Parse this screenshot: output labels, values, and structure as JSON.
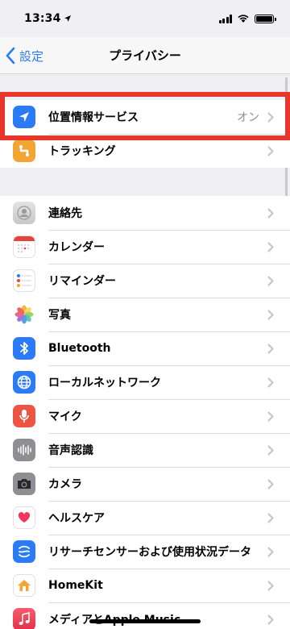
{
  "status_bar": {
    "time": "13:34",
    "location_arrow": "location-arrow-icon"
  },
  "nav": {
    "back_label": "設定",
    "title": "プライバシー"
  },
  "section1": [
    {
      "label": "位置情報サービス",
      "detail": "オン",
      "icon": "location-arrow-icon",
      "color": "#2c7bf6"
    },
    {
      "label": "トラッキング",
      "detail": "",
      "icon": "tracking-icon",
      "color": "#f3a533"
    }
  ],
  "section2": [
    {
      "label": "連絡先",
      "icon": "contacts-icon",
      "color": "#d9d9d9"
    },
    {
      "label": "カレンダー",
      "icon": "calendar-icon",
      "color": "#ffffff"
    },
    {
      "label": "リマインダー",
      "icon": "reminders-icon",
      "color": "#ffffff"
    },
    {
      "label": "写真",
      "icon": "photos-icon",
      "color": "#ffffff"
    },
    {
      "label": "Bluetooth",
      "icon": "bluetooth-icon",
      "color": "#2c7bf6"
    },
    {
      "label": "ローカルネットワーク",
      "icon": "network-icon",
      "color": "#2c7bf6"
    },
    {
      "label": "マイク",
      "icon": "microphone-icon",
      "color": "#ec5444"
    },
    {
      "label": "音声認識",
      "icon": "waveform-icon",
      "color": "#8e8e93"
    },
    {
      "label": "カメラ",
      "icon": "camera-icon",
      "color": "#8e8e93"
    },
    {
      "label": "ヘルスケア",
      "icon": "heart-icon",
      "color": "#ffffff"
    },
    {
      "label": "リサーチセンサーおよび使用状況データ",
      "icon": "research-icon",
      "color": "#2c7bf6"
    },
    {
      "label": "HomeKit",
      "icon": "home-icon",
      "color": "#f3a533"
    },
    {
      "label": "メディアとApple Music",
      "icon": "music-icon",
      "color": "#f04a5c"
    }
  ]
}
